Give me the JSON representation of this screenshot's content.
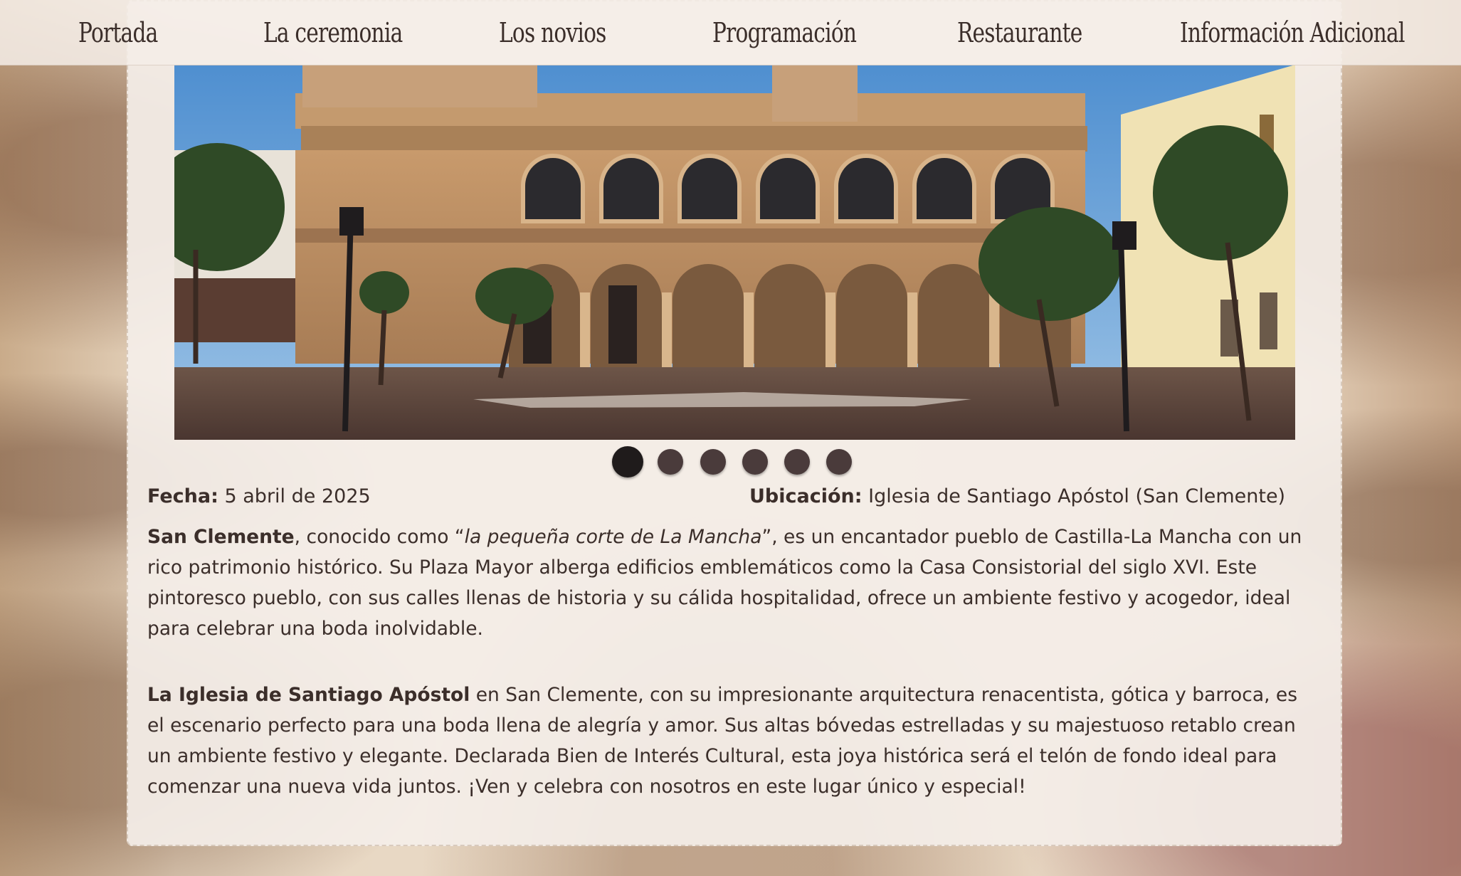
{
  "nav": {
    "items": [
      "Portada",
      "La ceremonia",
      "Los novios",
      "Programación",
      "Restaurante",
      "Información Adicional"
    ]
  },
  "carousel": {
    "slide_count": 6,
    "active_index": 0
  },
  "info": {
    "date_label": "Fecha:",
    "date_value": "5 abril de 2025",
    "location_label": "Ubicación:",
    "location_value": "Iglesia de Santiago Apóstol (San Clemente)"
  },
  "paragraph1": {
    "bold": "San Clemente",
    "text_a": ", conocido como “",
    "italic": "la pequeña corte de La Mancha",
    "text_b": "”, es un encantador pueblo de Castilla-La Mancha con un rico patrimonio histórico. Su Plaza Mayor alberga edificios emblemáticos como la Casa Consistorial del siglo XVI. Este pintoresco pueblo, con sus calles llenas de historia y su cálida hospitalidad, ofrece un ambiente festivo y acogedor, ideal para celebrar una boda inolvidable."
  },
  "paragraph2": {
    "bold": "La Iglesia de Santiago Apóstol",
    "text": " en San Clemente, con su impresionante arquitectura renacentista, gótica y barroca, es el escenario perfecto para una boda llena de alegría y amor. Sus altas bóvedas estrelladas y su majestuoso retablo crean un ambiente festivo y elegante. Declarada Bien de Interés Cultural, esta joya histórica será el telón de fondo ideal para comenzar una nueva vida juntos. ¡Ven y celebra con nosotros en este lugar único y especial!"
  },
  "colors": {
    "text": "#3b2e2a",
    "panel": "#f4eee8",
    "dot": "#4a3b3b",
    "dot_active": "#1f1b1b",
    "stone": "#b8895e",
    "sky": "#6aa4d8"
  }
}
